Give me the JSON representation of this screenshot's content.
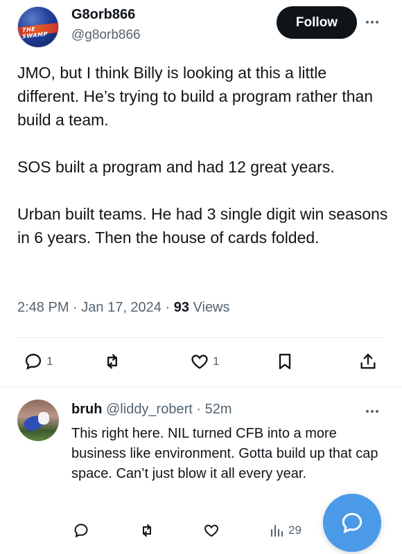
{
  "tweet": {
    "author": {
      "display_name": "G8orb866",
      "handle": "@g8orb866",
      "avatar_text": "THE SWAMP"
    },
    "follow_label": "Follow",
    "text": "JMO, but I think Billy is looking at this a little different. He’s trying to build a program rather than build a team.\n\nSOS built a program and had 12 great years.\n\nUrban built teams. He had 3 single digit win seasons in 6 years. Then the house of cards folded.",
    "time": "2:48 PM",
    "date": "Jan 17, 2024",
    "views_count": "93",
    "views_label": "Views",
    "reply_count": "1",
    "like_count": "1"
  },
  "reply": {
    "display_name": "bruh",
    "handle": "@liddy_robert",
    "age": "52m",
    "text": "This right here. NIL turned CFB into a more business like environment. Gotta build up that cap space. Can’t just blow it all every year.",
    "view_count": "29"
  },
  "colors": {
    "accent": "#1d9bf0",
    "fab": "#4a9ae8",
    "text_primary": "#0f1419",
    "text_secondary": "#536471"
  }
}
